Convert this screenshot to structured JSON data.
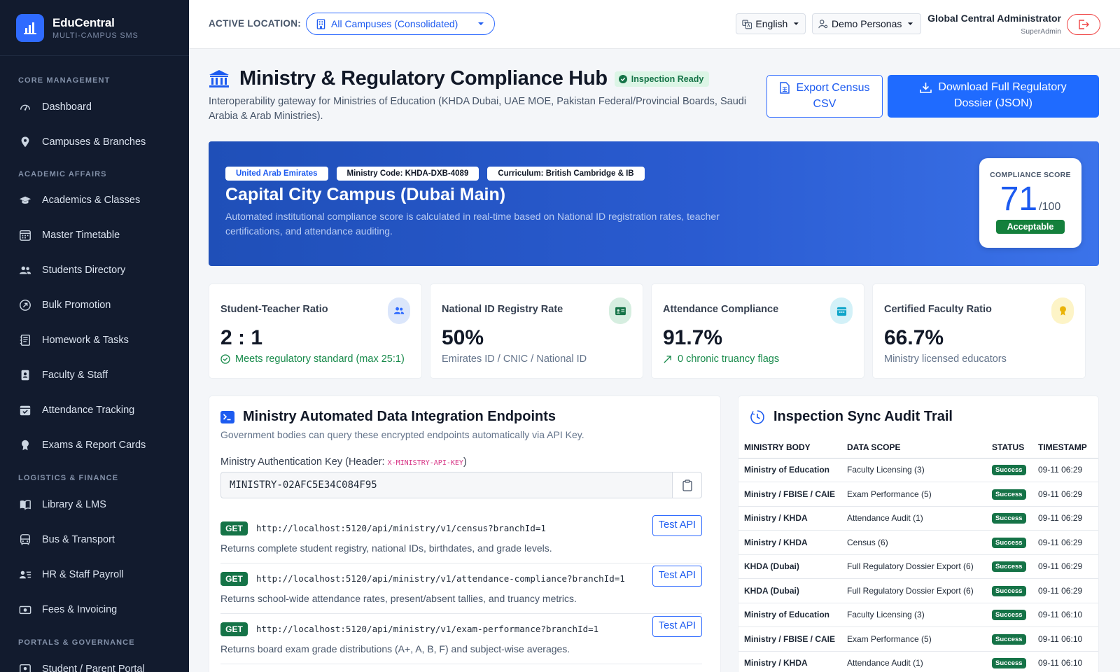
{
  "brand": {
    "name": "EduCentral",
    "subtitle": "MULTI-CAMPUS SMS"
  },
  "sidebar": {
    "sections": [
      {
        "title": "CORE MANAGEMENT",
        "items": [
          {
            "label": "Dashboard",
            "icon": "dashboard-icon"
          },
          {
            "label": "Campuses & Branches",
            "icon": "map-pin-icon"
          }
        ]
      },
      {
        "title": "ACADEMIC AFFAIRS",
        "items": [
          {
            "label": "Academics & Classes",
            "icon": "graduation-cap-icon"
          },
          {
            "label": "Master Timetable",
            "icon": "calendar-grid-icon"
          },
          {
            "label": "Students Directory",
            "icon": "users-icon"
          },
          {
            "label": "Bulk Promotion",
            "icon": "arrow-up-circle-icon"
          },
          {
            "label": "Homework & Tasks",
            "icon": "journal-icon"
          },
          {
            "label": "Faculty & Staff",
            "icon": "id-badge-icon"
          },
          {
            "label": "Attendance Tracking",
            "icon": "calendar-check-icon"
          },
          {
            "label": "Exams & Report Cards",
            "icon": "award-icon"
          }
        ]
      },
      {
        "title": "LOGISTICS & FINANCE",
        "items": [
          {
            "label": "Library & LMS",
            "icon": "book-icon"
          },
          {
            "label": "Bus & Transport",
            "icon": "bus-icon"
          },
          {
            "label": "HR & Staff Payroll",
            "icon": "person-lines-icon"
          },
          {
            "label": "Fees & Invoicing",
            "icon": "cash-icon"
          }
        ]
      },
      {
        "title": "PORTALS & GOVERNANCE",
        "items": [
          {
            "label": "Student / Parent Portal",
            "icon": "portal-icon"
          }
        ]
      }
    ]
  },
  "topbar": {
    "location_label": "ACTIVE LOCATION:",
    "location_value": "All Campuses (Consolidated)",
    "language": "English",
    "personas": "Demo Personas",
    "user_name": "Global Central Administrator",
    "user_role": "SuperAdmin"
  },
  "hub": {
    "title": "Ministry & Regulatory Compliance Hub",
    "badge": "Inspection Ready",
    "description": "Interoperability gateway for Ministries of Education (KHDA Dubai, UAE MOE, Pakistan Federal/Provincial Boards, Saudi Arabia & Arab Ministries).",
    "export_line1": "Export Census",
    "export_line2": "CSV",
    "download_line1": "Download Full Regulatory",
    "download_line2": "Dossier (JSON)"
  },
  "banner": {
    "tags": [
      "United Arab Emirates",
      "Ministry Code: KHDA-DXB-4089",
      "Curriculum: British Cambridge & IB"
    ],
    "campus": "Capital City Campus (Dubai Main)",
    "description": "Automated institutional compliance score is calculated in real-time based on National ID registration rates, teacher certifications, and attendance auditing.",
    "score_label": "COMPLIANCE SCORE",
    "score": "71",
    "score_max": "/100",
    "score_status": "Acceptable"
  },
  "stats": [
    {
      "label": "Student-Teacher Ratio",
      "value": "2 : 1",
      "sub": "Meets regulatory standard (max 25:1)",
      "icon": "users-icon",
      "color": "#2f6bff",
      "bg": "#dbe6fb"
    },
    {
      "label": "National ID Registry Rate",
      "value": "50%",
      "sub": "Emirates ID / CNIC / National ID",
      "icon": "id-card-icon",
      "color": "#157347",
      "bg": "#d6eee0"
    },
    {
      "label": "Attendance Compliance",
      "value": "91.7%",
      "sub": "0 chronic truancy flags",
      "icon": "calendar-icon",
      "color": "#0ea5c9",
      "bg": "#d3f1f8"
    },
    {
      "label": "Certified Faculty Ratio",
      "value": "66.7%",
      "sub": "Ministry licensed educators",
      "icon": "award-icon",
      "color": "#eab308",
      "bg": "#fdf4c7"
    }
  ],
  "endpoints": {
    "title": "Ministry Automated Data Integration Endpoints",
    "subtitle": "Government bodies can query these encrypted endpoints automatically via API Key.",
    "key_label": "Ministry Authentication Key (Header: ",
    "key_header": "X-MINISTRY-API-KEY",
    "key_label_end": ")",
    "key_value": "MINISTRY-02AFC5E34C084F95",
    "method": "GET",
    "test_label": "Test API",
    "items": [
      {
        "url": "http://localhost:5120/api/ministry/v1/census?branchId=1",
        "desc": "Returns complete student registry, national IDs, birthdates, and grade levels."
      },
      {
        "url": "http://localhost:5120/api/ministry/v1/attendance-compliance?branchId=1",
        "desc": "Returns school-wide attendance rates, present/absent tallies, and truancy metrics."
      },
      {
        "url": "http://localhost:5120/api/ministry/v1/exam-performance?branchId=1",
        "desc": "Returns board exam grade distributions (A+, A, B, F) and subject-wise averages."
      }
    ]
  },
  "audit": {
    "title": "Inspection Sync Audit Trail",
    "columns": [
      "MINISTRY BODY",
      "DATA SCOPE",
      "STATUS",
      "TIMESTAMP"
    ],
    "rows": [
      {
        "body": "Ministry of Education",
        "scope": "Faculty Licensing (3)",
        "status": "Success",
        "ts": "09-11 06:29"
      },
      {
        "body": "Ministry / FBISE / CAIE",
        "scope": "Exam Performance (5)",
        "status": "Success",
        "ts": "09-11 06:29"
      },
      {
        "body": "Ministry / KHDA",
        "scope": "Attendance Audit (1)",
        "status": "Success",
        "ts": "09-11 06:29"
      },
      {
        "body": "Ministry / KHDA",
        "scope": "Census (6)",
        "status": "Success",
        "ts": "09-11 06:29"
      },
      {
        "body": "KHDA (Dubai)",
        "scope": "Full Regulatory Dossier Export (6)",
        "status": "Success",
        "ts": "09-11 06:29"
      },
      {
        "body": "KHDA (Dubai)",
        "scope": "Full Regulatory Dossier Export (6)",
        "status": "Success",
        "ts": "09-11 06:29"
      },
      {
        "body": "Ministry of Education",
        "scope": "Faculty Licensing (3)",
        "status": "Success",
        "ts": "09-11 06:10"
      },
      {
        "body": "Ministry / FBISE / CAIE",
        "scope": "Exam Performance (5)",
        "status": "Success",
        "ts": "09-11 06:10"
      },
      {
        "body": "Ministry / KHDA",
        "scope": "Attendance Audit (1)",
        "status": "Success",
        "ts": "09-11 06:10"
      }
    ]
  },
  "colors": {
    "accent": "#1f6bff",
    "sidebar": "#121b2e",
    "success": "#157347"
  }
}
